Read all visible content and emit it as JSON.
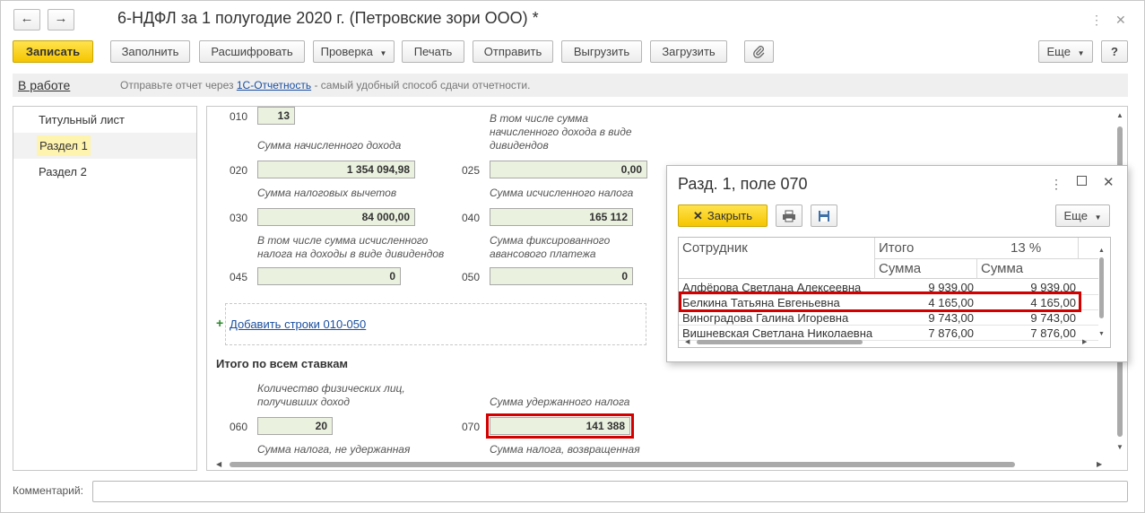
{
  "window": {
    "title": "6-НДФЛ за 1 полугодие 2020 г. (Петровские зори ООО) *",
    "nav_back": "←",
    "nav_forward": "→",
    "more_icon": "⋮",
    "close_icon": "✕"
  },
  "toolbar": {
    "save": "Записать",
    "fill": "Заполнить",
    "decode": "Расшифровать",
    "check": "Проверка",
    "print": "Печать",
    "send": "Отправить",
    "export": "Выгрузить",
    "import": "Загрузить",
    "more": "Еще",
    "help": "?"
  },
  "status": {
    "state": "В работе",
    "hint_prefix": "Отправьте отчет через",
    "hint_link": "1С-Отчетность",
    "hint_suffix": "- самый удобный способ сдачи отчетности."
  },
  "sections": [
    {
      "label": "Титульный лист"
    },
    {
      "label": "Раздел 1"
    },
    {
      "label": "Раздел 2"
    }
  ],
  "form": {
    "f010": {
      "code": "010",
      "value": "13"
    },
    "cap_010_right": "В том числе сумма начисленного дохода в виде дивидендов",
    "cap_020": "Сумма начисленного дохода",
    "f020": {
      "code": "020",
      "value": "1 354 094,98"
    },
    "f025": {
      "code": "025",
      "value": "0,00"
    },
    "cap_030": "Сумма налоговых вычетов",
    "cap_040": "Сумма исчисленного налога",
    "f030": {
      "code": "030",
      "value": "84 000,00"
    },
    "f040": {
      "code": "040",
      "value": "165 112"
    },
    "cap_045": "В том числе сумма исчисленного налога на доходы в виде дивидендов",
    "cap_050": "Сумма фиксированного авансового платежа",
    "f045": {
      "code": "045",
      "value": "0"
    },
    "f050": {
      "code": "050",
      "value": "0"
    },
    "add_plus": "+",
    "add_rows": "Добавить строки 010-050",
    "total_heading": "Итого по всем ставкам",
    "cap_060": "Количество физических лиц, получивших доход",
    "cap_070": "Сумма удержанного налога",
    "f060": {
      "code": "060",
      "value": "20"
    },
    "f070": {
      "code": "070",
      "value": "141 388"
    },
    "cap_080": "Сумма налога, не удержанная",
    "cap_090": "Сумма налога, возвращенная"
  },
  "popup": {
    "title": "Разд. 1, поле 070",
    "close_button": "Закрыть",
    "more": "Еще",
    "columns": {
      "employee": "Сотрудник",
      "total": "Итого",
      "rate": "13 %",
      "sum1": "Сумма",
      "sum2": "Сумма"
    },
    "rows": [
      {
        "name": "Алфёрова Светлана Алексеевна",
        "total": "9 939,00",
        "rate13": "9 939,00"
      },
      {
        "name": "Белкина Татьяна Евгеньевна",
        "total": "4 165,00",
        "rate13": "4 165,00"
      },
      {
        "name": "Виноградова Галина Игоревна",
        "total": "9 743,00",
        "rate13": "9 743,00"
      },
      {
        "name": "Вишневская Светлана Николаевна",
        "total": "7 876,00",
        "rate13": "7 876,00"
      }
    ]
  },
  "comment_label": "Комментарий:",
  "colors": {
    "primary": "#f5c500",
    "field_bg": "#eaf1df",
    "highlight": "#d40000",
    "link": "#1a4fa0",
    "selected": "#fff3b0"
  }
}
